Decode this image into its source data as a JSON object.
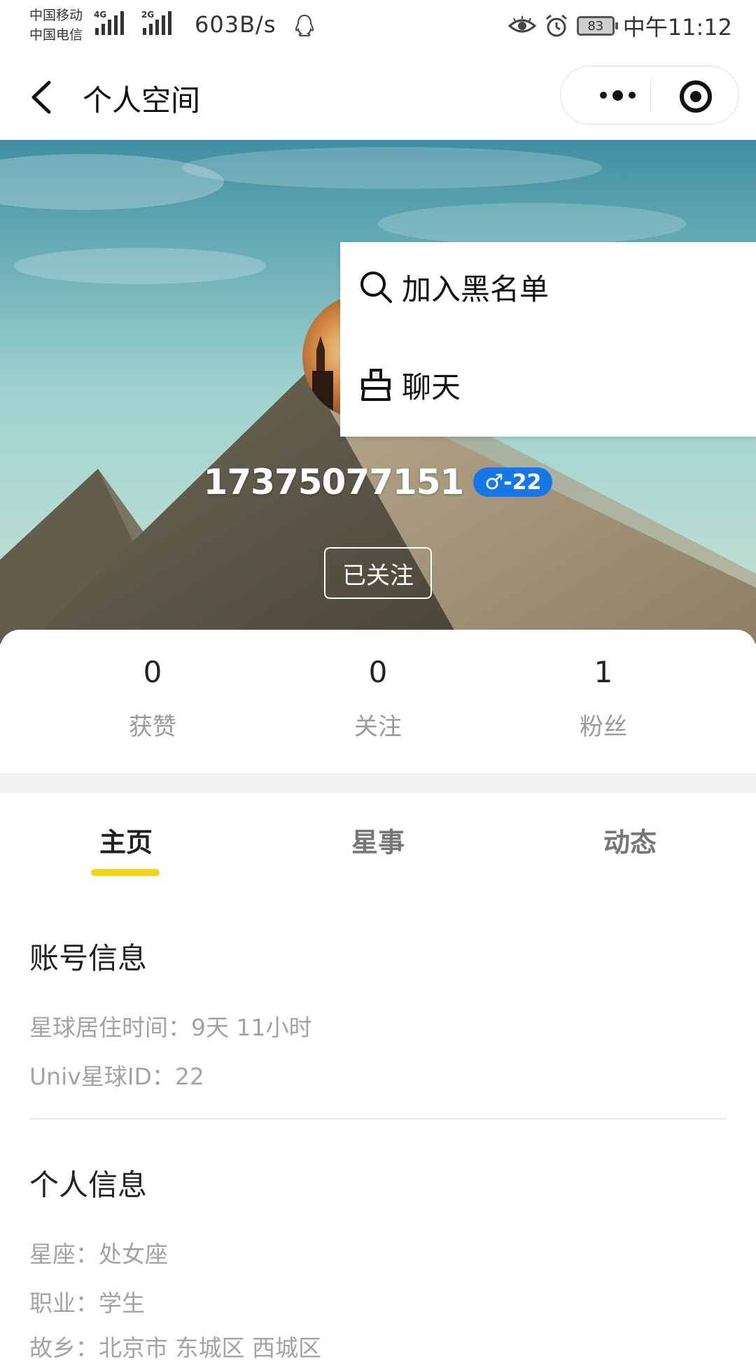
{
  "status_bar": {
    "carrier_1": "中国移动",
    "carrier_2": "中国电信",
    "net_label_1": "4G",
    "net_label_2": "2G",
    "net_speed": "603B/s",
    "battery": "83",
    "time": "中午11:12"
  },
  "nav": {
    "title": "个人空间"
  },
  "profile": {
    "username": "17375077151",
    "badge": "♂-22",
    "follow_label": "已关注"
  },
  "dropdown": {
    "items": [
      {
        "label": "加入黑名单",
        "icon": "search-icon"
      },
      {
        "label": "聊天",
        "icon": "broom-icon"
      }
    ]
  },
  "stats": [
    {
      "value": "0",
      "label": "获赞"
    },
    {
      "value": "0",
      "label": "关注"
    },
    {
      "value": "1",
      "label": "粉丝"
    }
  ],
  "tabs": [
    {
      "label": "主页",
      "active": true
    },
    {
      "label": "星事",
      "active": false
    },
    {
      "label": "动态",
      "active": false
    }
  ],
  "account_info": {
    "title": "账号信息",
    "lines": [
      "星球居住时间：9天 11小时",
      "Univ星球ID：22"
    ]
  },
  "personal_info": {
    "title": "个人信息",
    "lines": [
      "星座：处女座",
      "职业：学生",
      "故乡：北京市 东城区 西城区"
    ]
  },
  "colors": {
    "accent_yellow": "#f5d318",
    "badge_blue": "#1677e8"
  }
}
